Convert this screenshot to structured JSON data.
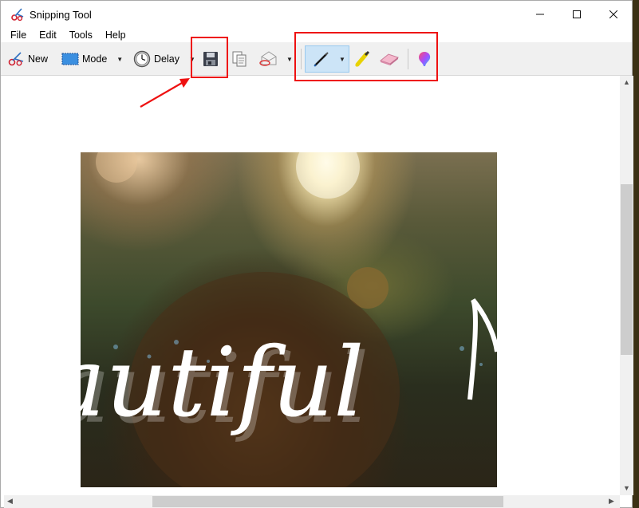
{
  "window": {
    "title": "Snipping Tool"
  },
  "menu": [
    "File",
    "Edit",
    "Tools",
    "Help"
  ],
  "toolbar": {
    "new_label": "New",
    "mode_label": "Mode",
    "delay_label": "Delay"
  },
  "image_text": "autiful"
}
